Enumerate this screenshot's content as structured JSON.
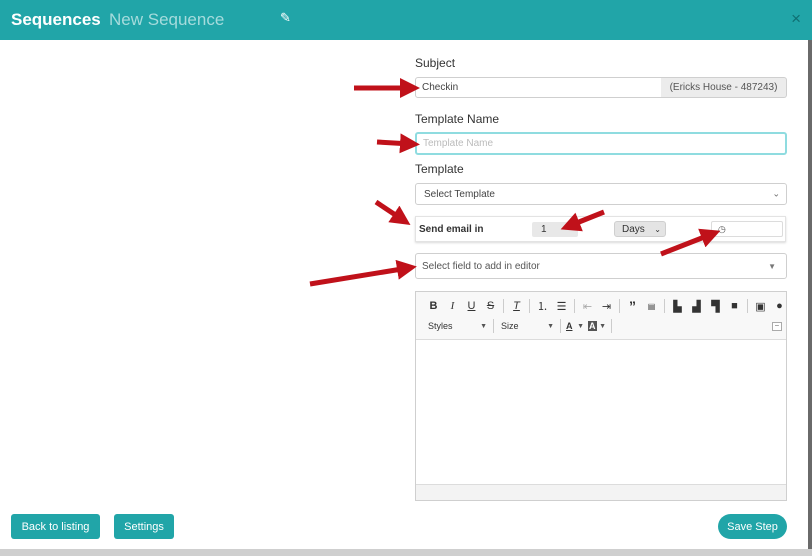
{
  "header": {
    "title": "Sequences",
    "subtitle": "New Sequence",
    "edit_icon": "pencil-icon",
    "close_icon": "close-icon",
    "close_glyph": "×"
  },
  "form": {
    "subject_label": "Subject",
    "subject_value": "Checkin",
    "subject_addon": "(Ericks House - 487243)",
    "template_name_label": "Template Name",
    "template_name_placeholder": "Template Name",
    "template_label": "Template",
    "template_select": "Select Template",
    "send_label": "Send email in",
    "send_value": "1",
    "send_unit": "Days",
    "time_icon": "clock-icon",
    "field_select": "Select field to add in editor"
  },
  "editor": {
    "styles_label": "Styles",
    "size_label": "Size"
  },
  "footer": {
    "back_label": "Back to listing",
    "settings_label": "Settings",
    "save_label": "Save Step"
  },
  "colors": {
    "header": "#21a5a8",
    "button": "#21a5a8",
    "arrow": "#c0111a"
  }
}
